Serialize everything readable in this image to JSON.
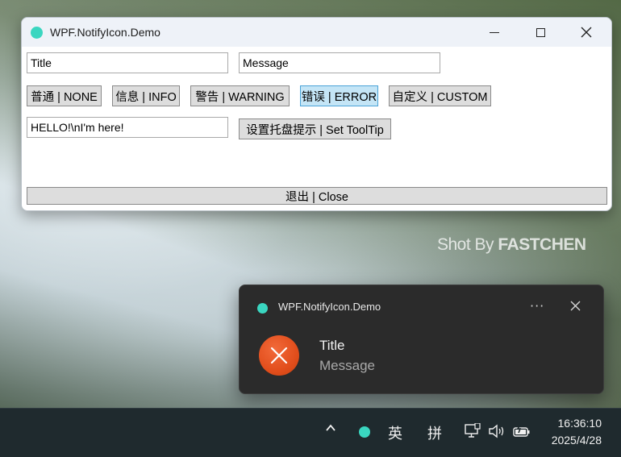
{
  "window": {
    "title": "WPF.NotifyIcon.Demo",
    "controls": {
      "minimize": "minimize",
      "maximize": "maximize",
      "close": "close"
    }
  },
  "form": {
    "title_value": "Title",
    "message_value": "Message",
    "tooltip_value": "HELLO!\\nI'm here!",
    "buttons": {
      "none": "普通 | NONE",
      "info": "信息 | INFO",
      "warning": "警告 | WARNING",
      "error": "错误 | ERROR",
      "custom": "自定义 | CUSTOM",
      "set_tooltip": "设置托盘提示 | Set ToolTip",
      "close": "退出 | Close"
    }
  },
  "watermark": {
    "prefix": "Shot By ",
    "name": "FASTCHEN"
  },
  "toast": {
    "app_name": "WPF.NotifyIcon.Demo",
    "title": "Title",
    "message": "Message",
    "icon": "error-icon"
  },
  "taskbar": {
    "ime_mode": "英",
    "ime_input": "拼",
    "time": "16:36:10",
    "date": "2025/4/28"
  },
  "colors": {
    "accent_active_button": "#c4e5f6",
    "toast_background": "#2b2b2b",
    "error_icon": "#e24e1c",
    "app_icon": "#3ad6c0"
  }
}
